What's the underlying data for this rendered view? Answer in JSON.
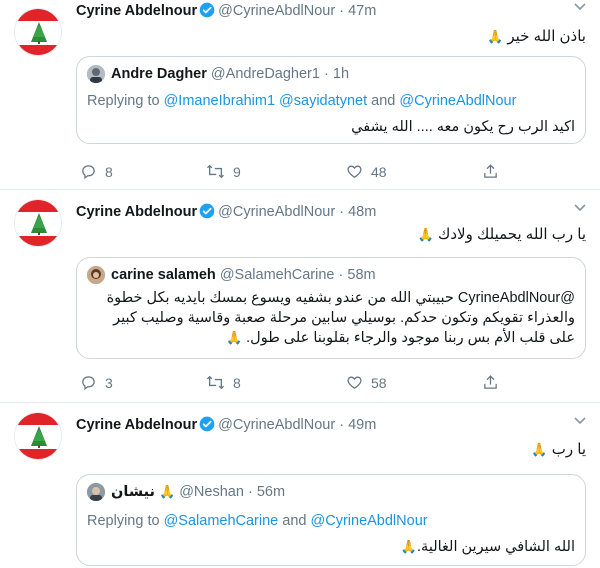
{
  "tweets": [
    {
      "name": "Cyrine Abdelnour",
      "handle": "@CyrineAbdlNour",
      "dot": "·",
      "time": "47m",
      "text": "باذن الله خير",
      "quote": {
        "name": "Andre Dagher",
        "handle": "@AndreDagher1",
        "dot": "·",
        "time": "1h",
        "reply_prefix": "Replying to",
        "reply_mentions": "@ImaneIbrahim1 @sayidatynet",
        "reply_and": "and",
        "reply_last": "@CyrineAbdlNour",
        "lines": [
          "اكيد الرب رح يكون معه .... الله يشفي"
        ]
      },
      "replies": "8",
      "retweets": "9",
      "likes": "48"
    },
    {
      "name": "Cyrine Abdelnour",
      "handle": "@CyrineAbdlNour",
      "dot": "·",
      "time": "48m",
      "text": "يا رب الله يحميلك ولادك",
      "quote": {
        "name": "carine salameh",
        "handle": "@SalamehCarine",
        "dot": "·",
        "time": "58m",
        "lines": [
          "@CyrineAbdlNour حبيبتي الله من عندو بشفيه ويسوع بمسك بايديه بكل خطوة",
          "والعذراء تقويكم وتكون حدكم. بوسيلي سابين مرحلة صعبة وقاسية وصليب كبير",
          "على قلب الأم بس ربنا موجود والرجاء بقلوبنا على طول."
        ]
      },
      "replies": "3",
      "retweets": "8",
      "likes": "58"
    },
    {
      "name": "Cyrine Abdelnour",
      "handle": "@CyrineAbdlNour",
      "dot": "·",
      "time": "49m",
      "text": "يا رب",
      "quote": {
        "name": "نيشان",
        "handle": "@Neshan",
        "dot": "·",
        "time": "56m",
        "reply_prefix": "Replying to",
        "reply_mentions": "@SalamehCarine",
        "reply_and": "and",
        "reply_last": "@CyrineAbdlNour",
        "lines": [
          "الله الشافي سيرين الغالية."
        ]
      }
    }
  ],
  "colors": {
    "link": "#1b95e0",
    "muted": "#657786",
    "verified": "#1da1f2",
    "flag_red": "#e0242a",
    "cedar_green": "#2e8b3a"
  },
  "icons": [
    "verified-icon",
    "chevron-down-icon",
    "reply-icon",
    "retweet-icon",
    "like-icon",
    "share-icon",
    "praying-hands-icon"
  ]
}
